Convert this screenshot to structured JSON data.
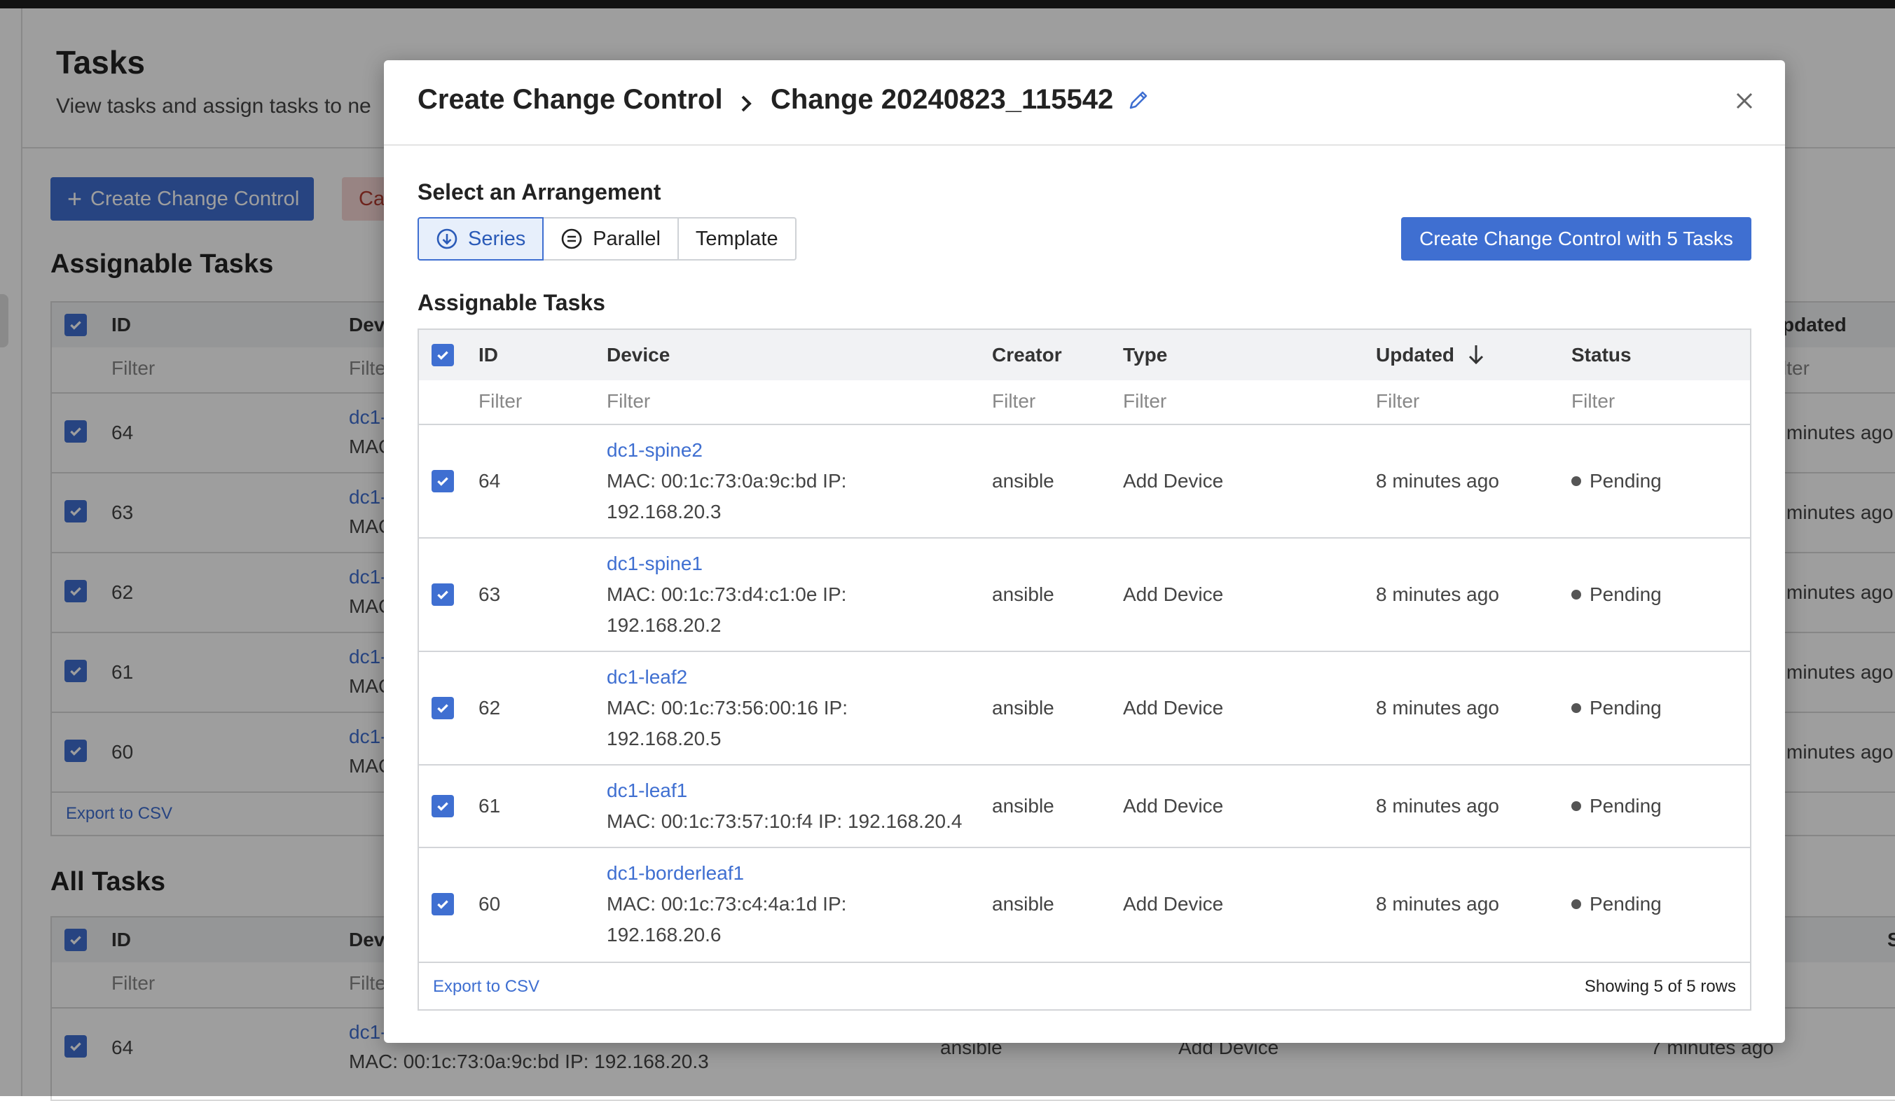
{
  "background": {
    "title": "Tasks",
    "subtitle": "View tasks and assign tasks to ne",
    "create_button": "Create Change Control",
    "cancel_button_partial": "Ca",
    "assignable_heading": "Assignable Tasks",
    "all_heading": "All Tasks",
    "header_id": "ID",
    "header_device": "Dev",
    "header_updated": "pdated",
    "header_status_partial": "S",
    "filter": "Filter",
    "filter_partial": "Filte",
    "filter_right": "lter",
    "export": "Export to CSV",
    "rows": [
      {
        "id": "64",
        "dev": "dc1-",
        "mac": "MAC",
        "updated": "minutes ago"
      },
      {
        "id": "63",
        "dev": "dc1-",
        "mac": "MAC",
        "updated": "minutes ago"
      },
      {
        "id": "62",
        "dev": "dc1-",
        "mac": "MAC",
        "updated": "minutes ago"
      },
      {
        "id": "61",
        "dev": "dc1-",
        "mac": "MAC",
        "updated": "minutes ago"
      },
      {
        "id": "60",
        "dev": "dc1-",
        "mac": "MAC",
        "updated": "minutes ago"
      }
    ],
    "all_row": {
      "id": "64",
      "dev": "dc1-",
      "mac": "MAC: 00:1c:73:0a:9c:bd IP: 192.168.20.3",
      "creator": "ansible",
      "type": "Add Device",
      "updated": "7 minutes ago"
    }
  },
  "modal": {
    "title": "Create Change Control",
    "change_name": "Change 20240823_115542",
    "arrangement_label": "Select an Arrangement",
    "arrangements": [
      "Series",
      "Parallel",
      "Template"
    ],
    "selected_arrangement": "Series",
    "create_button": "Create Change Control with 5 Tasks",
    "tasks_label": "Assignable Tasks",
    "columns": [
      "ID",
      "Device",
      "Creator",
      "Type",
      "Updated",
      "Status"
    ],
    "filter_placeholder": "Filter",
    "rows": [
      {
        "id": "64",
        "device": "dc1-spine2",
        "mac_line1": "MAC: 00:1c:73:0a:9c:bd IP:",
        "mac_line2": "192.168.20.3",
        "creator": "ansible",
        "type": "Add Device",
        "updated": "8 minutes ago",
        "status": "Pending"
      },
      {
        "id": "63",
        "device": "dc1-spine1",
        "mac_line1": "MAC: 00:1c:73:d4:c1:0e IP:",
        "mac_line2": "192.168.20.2",
        "creator": "ansible",
        "type": "Add Device",
        "updated": "8 minutes ago",
        "status": "Pending"
      },
      {
        "id": "62",
        "device": "dc1-leaf2",
        "mac_line1": "MAC: 00:1c:73:56:00:16 IP:",
        "mac_line2": "192.168.20.5",
        "creator": "ansible",
        "type": "Add Device",
        "updated": "8 minutes ago",
        "status": "Pending"
      },
      {
        "id": "61",
        "device": "dc1-leaf1",
        "mac_line1": "MAC: 00:1c:73:57:10:f4 IP: 192.168.20.4",
        "mac_line2": "",
        "creator": "ansible",
        "type": "Add Device",
        "updated": "8 minutes ago",
        "status": "Pending"
      },
      {
        "id": "60",
        "device": "dc1-borderleaf1",
        "mac_line1": "MAC: 00:1c:73:c4:4a:1d IP:",
        "mac_line2": "192.168.20.6",
        "creator": "ansible",
        "type": "Add Device",
        "updated": "8 minutes ago",
        "status": "Pending"
      }
    ],
    "export": "Export to CSV",
    "showing": "Showing 5 of 5 rows"
  },
  "icons": [
    "chevron-right-icon",
    "pencil-icon",
    "close-icon",
    "arrow-down-circle-icon",
    "equals-circle-icon",
    "sort-down-icon",
    "check-icon",
    "plus-icon",
    "status-dot-icon"
  ],
  "colors": {
    "accent": "#3f6fd1",
    "selected_bg": "#e7effb",
    "header_bg": "#f1f2f4",
    "border": "#d3d5d8"
  }
}
